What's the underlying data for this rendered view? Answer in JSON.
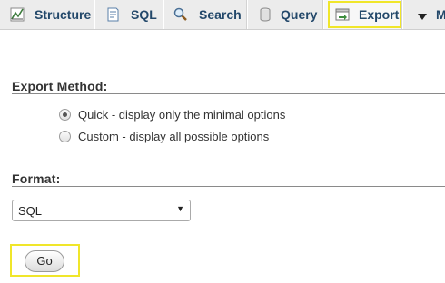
{
  "tabs": {
    "structure": "Structure",
    "sql": "SQL",
    "search": "Search",
    "query": "Query",
    "export": "Export",
    "more": "M"
  },
  "export_method": {
    "title": "Export Method:",
    "options": [
      {
        "label": "Quick - display only the minimal options",
        "selected": true
      },
      {
        "label": "Custom - display all possible options",
        "selected": false
      }
    ]
  },
  "format": {
    "title": "Format:",
    "selected": "SQL"
  },
  "go_button": {
    "label": "Go"
  },
  "colors": {
    "highlight": "#f0e62a",
    "tab_text": "#23486a",
    "tab_bar": "#ececec"
  }
}
